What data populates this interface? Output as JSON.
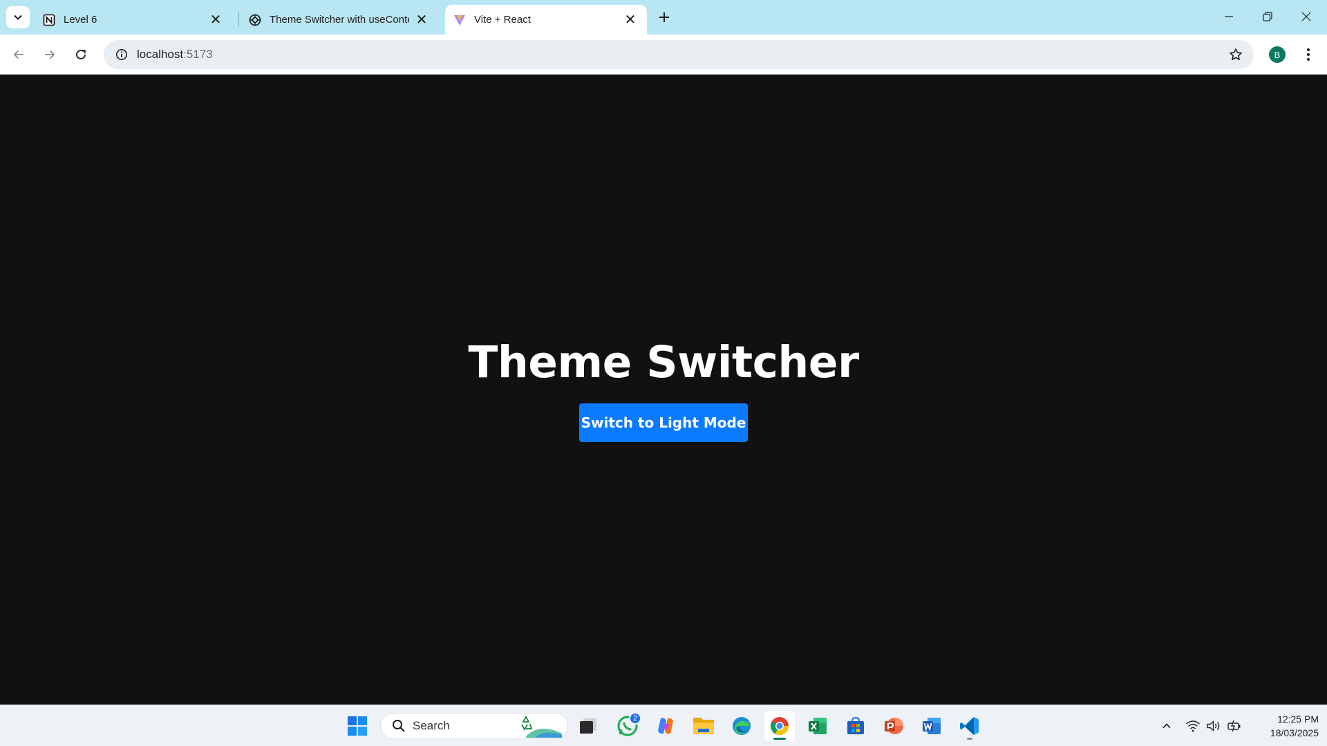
{
  "browser": {
    "tabs": [
      {
        "title": "Level 6",
        "icon": "notion-icon",
        "active": false
      },
      {
        "title": "Theme Switcher with useConte",
        "icon": "openai-icon",
        "active": false
      },
      {
        "title": "Vite + React",
        "icon": "vite-icon",
        "active": true
      }
    ],
    "address": {
      "host": "localhost",
      "port": ":5173"
    },
    "profile_initial": "B"
  },
  "page": {
    "title": "Theme Switcher",
    "button_label": "Switch to Light Mode",
    "background": "#111111",
    "button_color": "#0a7bff"
  },
  "taskbar": {
    "search_label": "Search",
    "whatsapp_badge": "2",
    "apps": [
      "start-icon",
      "search",
      "task-view-icon",
      "whatsapp-icon",
      "copilot-icon",
      "file-explorer-icon",
      "edge-icon",
      "chrome-icon",
      "excel-icon",
      "microsoft-store-icon",
      "powerpoint-icon",
      "word-icon",
      "vscode-icon"
    ],
    "time": "12:25 PM",
    "date": "18/03/2025"
  }
}
